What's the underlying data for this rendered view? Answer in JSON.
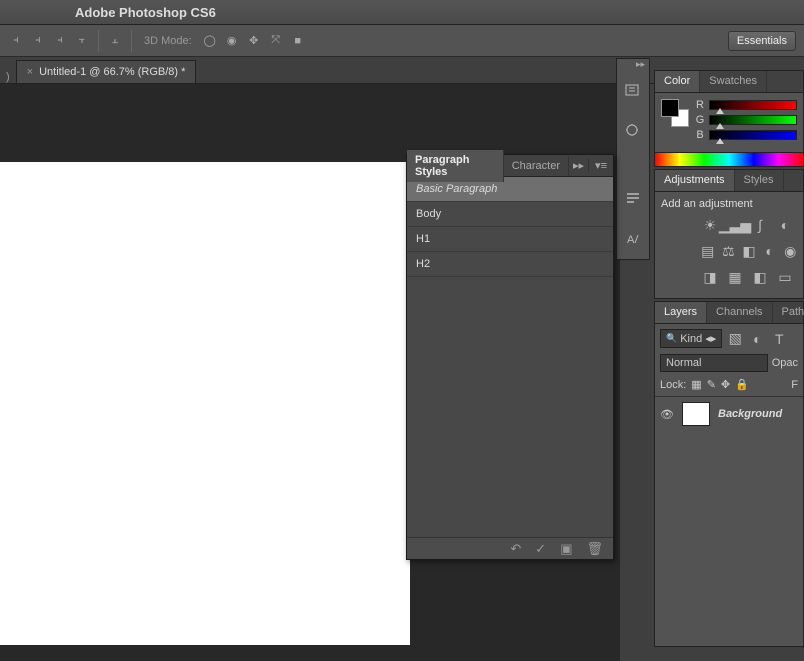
{
  "app": {
    "title": "Adobe Photoshop CS6"
  },
  "optbar": {
    "mode_label": "3D Mode:",
    "workspace_button": "Essentials"
  },
  "document": {
    "tab_title": "Untitled-1 @ 66.7% (RGB/8) *"
  },
  "color_panel": {
    "tabs": {
      "color": "Color",
      "swatches": "Swatches"
    },
    "channels": {
      "r": "R",
      "g": "G",
      "b": "B"
    }
  },
  "adjustments_panel": {
    "tabs": {
      "adjustments": "Adjustments",
      "styles": "Styles"
    },
    "heading": "Add an adjustment"
  },
  "layers_panel": {
    "tabs": {
      "layers": "Layers",
      "channels": "Channels",
      "paths": "Paths"
    },
    "filter_label": "Kind",
    "blend_mode": "Normal",
    "opacity_label": "Opac",
    "lock_label": "Lock:",
    "fill_label": "F",
    "layers": [
      {
        "name": "Background"
      }
    ]
  },
  "paragraph_styles_panel": {
    "tabs": {
      "paragraph": "Paragraph Styles",
      "character": "Character"
    },
    "items": [
      {
        "name": "Basic Paragraph",
        "selected": true
      },
      {
        "name": "Body"
      },
      {
        "name": "H1"
      },
      {
        "name": "H2"
      }
    ]
  }
}
